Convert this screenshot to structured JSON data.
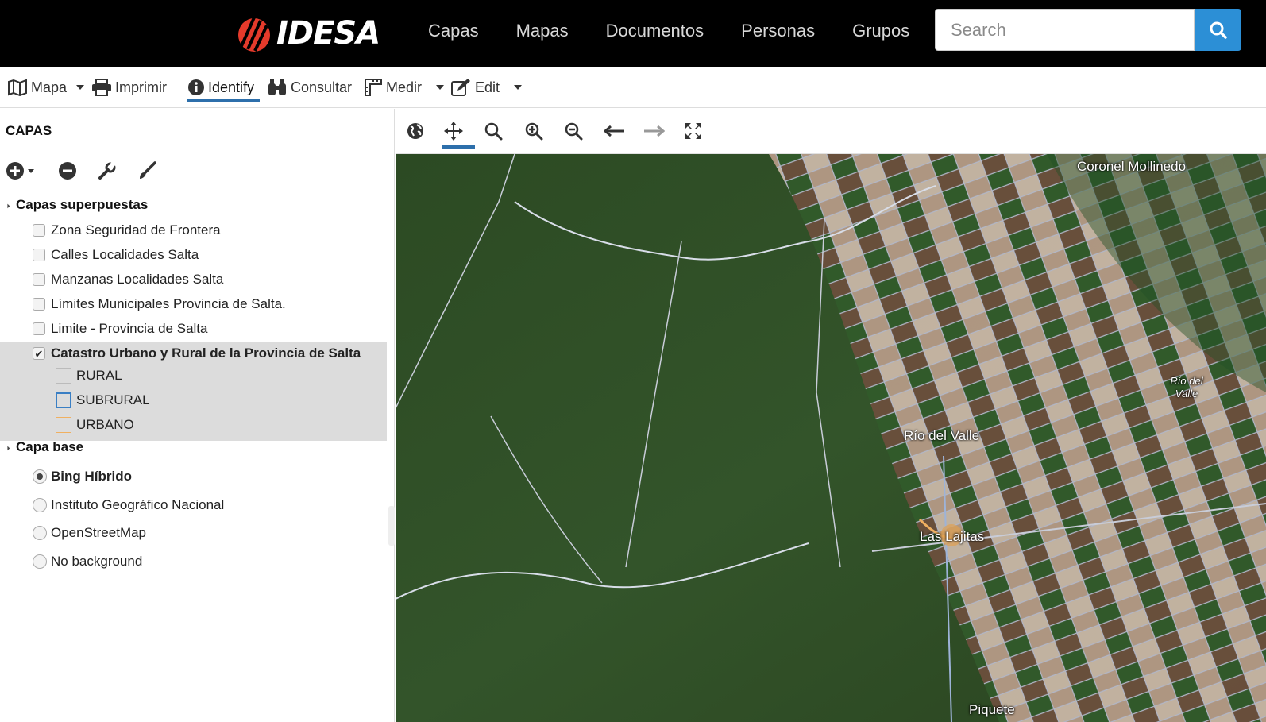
{
  "brand": {
    "name": "IDESA"
  },
  "nav": {
    "items": [
      "Capas",
      "Mapas",
      "Documentos",
      "Personas",
      "Grupos"
    ]
  },
  "search": {
    "placeholder": "Search"
  },
  "toolbar": {
    "items": [
      {
        "label": "Mapa",
        "icon": "map-icon",
        "caret": true
      },
      {
        "label": "Imprimir",
        "icon": "print-icon",
        "caret": false
      },
      {
        "label": "Identify",
        "icon": "info-icon",
        "caret": false,
        "active": true
      },
      {
        "label": "Consultar",
        "icon": "binoculars-icon",
        "caret": false
      },
      {
        "label": "Medir",
        "icon": "ruler-icon",
        "caret": true
      },
      {
        "label": "Edit",
        "icon": "edit-icon",
        "caret": true
      }
    ]
  },
  "panel": {
    "title": "CAPAS",
    "overlays": {
      "title": "Capas superpuestas",
      "layers": [
        {
          "label": "Zona Seguridad de Frontera",
          "checked": false
        },
        {
          "label": "Calles Localidades Salta",
          "checked": false
        },
        {
          "label": "Manzanas Localidades Salta",
          "checked": false
        },
        {
          "label": "Límites Municipales Provincia de Salta.",
          "checked": false
        },
        {
          "label": "Limite - Provincia de Salta",
          "checked": false
        },
        {
          "label": "Catastro Urbano y Rural de la Provincia de Salta",
          "checked": true
        }
      ],
      "legend": [
        {
          "label": "RURAL",
          "color": "#bbbbbb"
        },
        {
          "label": "SUBRURAL",
          "color": "#3a7fc4"
        },
        {
          "label": "URBANO",
          "color": "#f0b060"
        }
      ]
    },
    "base": {
      "title": "Capa base",
      "options": [
        {
          "label": "Bing Híbrido",
          "selected": true
        },
        {
          "label": "Instituto Geográfico Nacional",
          "selected": false
        },
        {
          "label": "OpenStreetMap",
          "selected": false
        },
        {
          "label": "No background",
          "selected": false
        }
      ]
    }
  },
  "map": {
    "labels": [
      "Coronel Mollinedo",
      "Río del Valle",
      "Las Lajitas",
      "Río del Valle",
      "Piquete"
    ]
  },
  "colors": {
    "accent": "#2c8fd6",
    "active_underline": "#2d6fab",
    "logo_red": "#e53a2b"
  }
}
